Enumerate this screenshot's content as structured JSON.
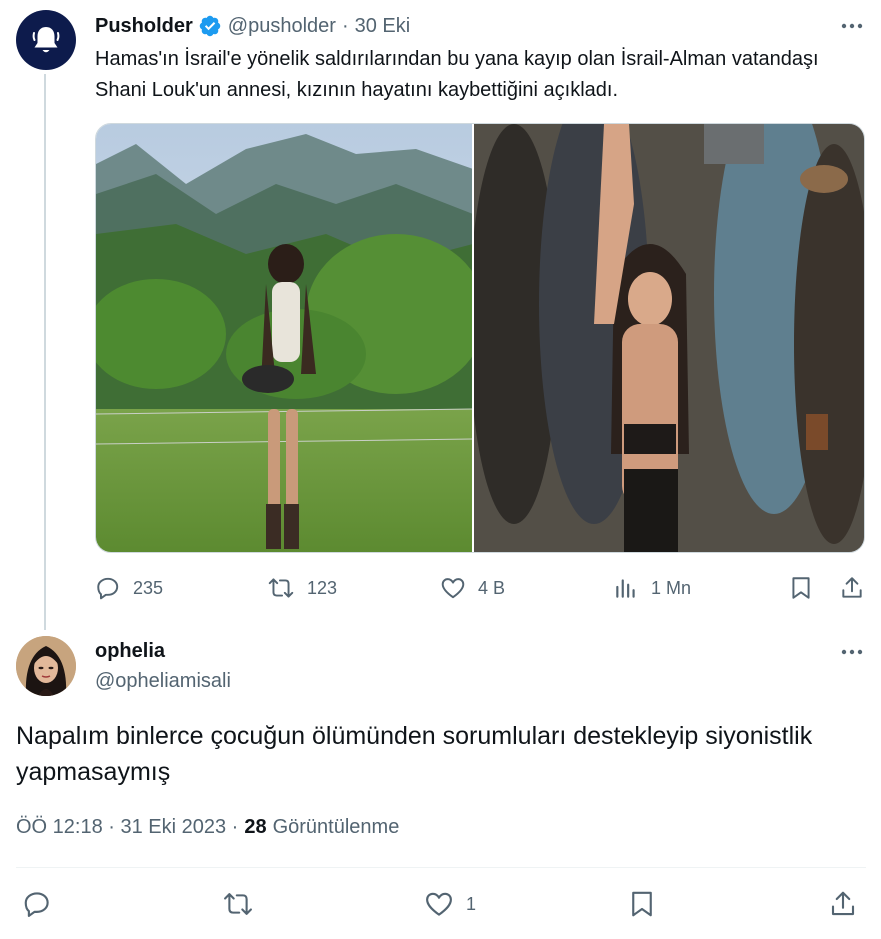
{
  "original_tweet": {
    "author_name": "Pusholder",
    "handle": "@pusholder",
    "separator": "·",
    "date": "30 Eki",
    "text": "Hamas'ın İsrail'e yönelik saldırılarından bu yana kayıp olan İsrail-Alman vatandaşı Shani Louk'un annesi, kızının hayatını kaybettiğini açıkladı.",
    "avatar_icon": "bell-icon",
    "verified_icon": "verified-badge-icon",
    "stats": {
      "replies": "235",
      "retweets": "123",
      "likes": "4 B",
      "views": "1 Mn"
    }
  },
  "reply": {
    "author_name": "ophelia",
    "handle": "@opheliamisali",
    "text": "Napalım binlerce çocuğun ölümünden sorumluları destekleyip siyonistlik yapmasaymış",
    "timestamp": "ÖÖ 12:18 · 31 Eki 2023 ·",
    "views_count": "28",
    "views_label": "Görüntülenme",
    "likes": "1"
  },
  "colors": {
    "text_primary": "#0f1419",
    "text_secondary": "#536471",
    "verified_blue": "#1d9bf0",
    "thread_line": "#cfd9de",
    "avatar_bg": "#0d1b4c"
  }
}
